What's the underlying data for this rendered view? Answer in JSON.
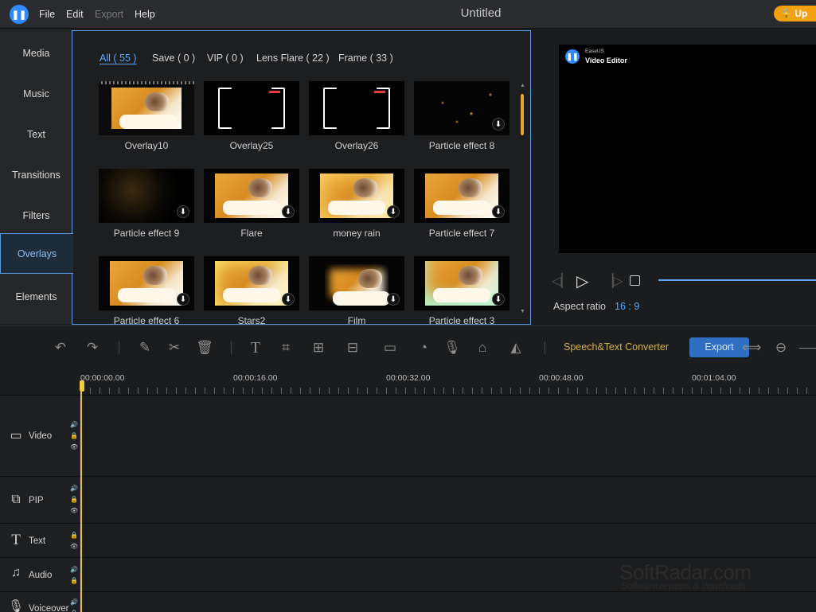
{
  "menu": {
    "logo": "app-logo-icon",
    "items": [
      "File",
      "Edit",
      "Export",
      "Help"
    ],
    "disabled": [
      "Export"
    ],
    "title": "Untitled",
    "upgrade_label": "Up"
  },
  "sidebar": {
    "items": [
      "Media",
      "Music",
      "Text",
      "Transitions",
      "Filters",
      "Overlays",
      "Elements"
    ],
    "active": "Overlays"
  },
  "library": {
    "filters": [
      "All ( 55 )",
      "Save ( 0 )",
      "VIP ( 0 )",
      "Lens Flare ( 22 )",
      "Frame ( 33 )"
    ],
    "active_filter": "All ( 55 )",
    "items": [
      {
        "label": "Overlay10",
        "style": "cat-film",
        "download": false
      },
      {
        "label": "Overlay25",
        "style": "frame",
        "download": false
      },
      {
        "label": "Overlay26",
        "style": "frame",
        "download": false
      },
      {
        "label": "Particle effect 8",
        "style": "dark-particles",
        "download": true
      },
      {
        "label": "Particle effect 9",
        "style": "dark-glow",
        "download": true
      },
      {
        "label": "Flare",
        "style": "cat",
        "download": true
      },
      {
        "label": "money rain",
        "style": "cat-sparkle",
        "download": true
      },
      {
        "label": "Particle effect 7",
        "style": "cat",
        "download": true
      },
      {
        "label": "Particle effect 6",
        "style": "cat",
        "download": true
      },
      {
        "label": "Stars2",
        "style": "cat-stars",
        "download": true
      },
      {
        "label": "Film",
        "style": "cat-vignette",
        "download": true
      },
      {
        "label": "Particle effect 3",
        "style": "cat-swirl",
        "download": true
      }
    ],
    "download_glyph": "⬇"
  },
  "preview": {
    "watermark_brand": "EaseUS",
    "watermark_product": "Video Editor",
    "aspect_label": "Aspect ratio",
    "aspect_value": "16 : 9"
  },
  "toolbar": {
    "tools": [
      "undo-icon",
      "redo-icon",
      "pen-icon",
      "scissors-icon",
      "trash-icon",
      "text-tool-icon",
      "crop-icon",
      "zoom-crop-icon",
      "mosaic-icon",
      "freeze-frame-icon",
      "speed-icon",
      "microphone-icon",
      "presentation-icon",
      "paint-bucket-icon"
    ],
    "speech_label": "Speech&Text Converter",
    "export_label": "Export"
  },
  "timeline": {
    "ticks": [
      "00:00:00.00",
      "00:00:16.00",
      "00:00:32.00",
      "00:00:48.00",
      "00:01:04.00"
    ],
    "tracks": [
      {
        "name": "Video",
        "icon": "video-track-icon"
      },
      {
        "name": "PIP",
        "icon": "pip-track-icon"
      },
      {
        "name": "Text",
        "icon": "text-track-icon"
      },
      {
        "name": "Audio",
        "icon": "audio-track-icon"
      },
      {
        "name": "Voiceover",
        "icon": "voiceover-track-icon"
      }
    ]
  },
  "watermark": {
    "site": "SoftRadar.com",
    "tagline": "Software reviews & downloads"
  },
  "colors": {
    "accent": "#5aa8ff",
    "upgrade": "#f3a111",
    "playhead": "#e7c240",
    "export_button": "#2f6fc1"
  }
}
